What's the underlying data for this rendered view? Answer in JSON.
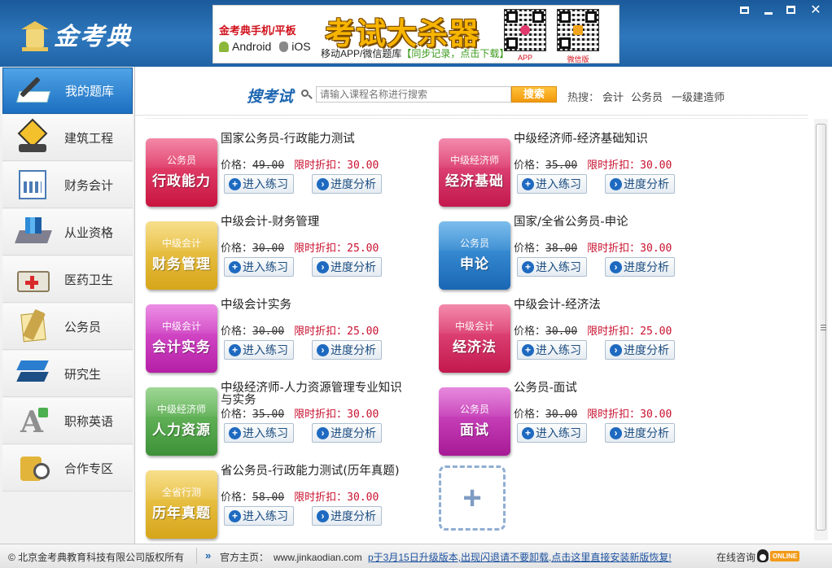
{
  "app": {
    "logo_text": "金考典",
    "window_controls": [
      "tile",
      "minimize",
      "maximize",
      "close"
    ]
  },
  "banner": {
    "line1": "金考典手机/平板",
    "os_android": "Android",
    "os_ios": "iOS",
    "headline": "考试大杀器",
    "sub_prefix": "移动APP/微信题库",
    "sub_highlight": "【同步记录，点击下载】",
    "qr1_caption": "APP",
    "qr2_caption": "微信版"
  },
  "sidebar": {
    "items": [
      {
        "label": "我的题库",
        "icon": "book-pen-icon",
        "active": true
      },
      {
        "label": "建筑工程",
        "icon": "construction-sign-icon",
        "active": false
      },
      {
        "label": "财务会计",
        "icon": "finance-chart-icon",
        "active": false
      },
      {
        "label": "从业资格",
        "icon": "bar-chart-icon",
        "active": false
      },
      {
        "label": "医药卫生",
        "icon": "medical-kit-icon",
        "active": false
      },
      {
        "label": "公务员",
        "icon": "civil-servant-icon",
        "active": false
      },
      {
        "label": "研究生",
        "icon": "layers-icon",
        "active": false
      },
      {
        "label": "职称英语",
        "icon": "letter-a-icon",
        "active": false
      },
      {
        "label": "合作专区",
        "icon": "cooperation-icon",
        "active": false
      }
    ]
  },
  "search": {
    "title": "搜考试",
    "placeholder": "请输入课程名称进行搜索",
    "button": "搜索",
    "hot_label": "热搜：",
    "hot_tags": [
      "会计",
      "公务员",
      "一级建造师"
    ]
  },
  "labels": {
    "price": "价格：",
    "discount": "限时折扣：",
    "practice": "进入练习",
    "analyze": "进度分析"
  },
  "courses": [
    {
      "name": "国家公务员-行政能力测试",
      "tile_small": "公务员",
      "tile_big": "行政能力",
      "color": "#d91a4d",
      "price": "49.00",
      "discount": "30.00"
    },
    {
      "name": "中级经济师-经济基础知识",
      "tile_small": "中级经济师",
      "tile_big": "经济基础",
      "color": "#d4184f",
      "price": "35.00",
      "discount": "30.00"
    },
    {
      "name": "中级会计-财务管理",
      "tile_small": "中级会计",
      "tile_big": "财务管理",
      "color": "#e0b32a",
      "price": "30.00",
      "discount": "25.00"
    },
    {
      "name": "国家/全省公务员-申论",
      "tile_small": "公务员",
      "tile_big": "申论",
      "color": "#2176c8",
      "price": "38.00",
      "discount": "30.00"
    },
    {
      "name": "中级会计实务",
      "tile_small": "中级会计",
      "tile_big": "会计实务",
      "color": "#c934bb",
      "price": "30.00",
      "discount": "25.00"
    },
    {
      "name": "中级会计-经济法",
      "tile_small": "中级会计",
      "tile_big": "经济法",
      "color": "#d0205a",
      "price": "30.00",
      "discount": "25.00"
    },
    {
      "name": "中级经济师-人力资源管理专业知识与实务",
      "tile_small": "中级经济师",
      "tile_big": "人力资源",
      "color": "#52a547",
      "price": "35.00",
      "discount": "30.00"
    },
    {
      "name": "公务员-面试",
      "tile_small": "公务员",
      "tile_big": "面试",
      "color": "#b827a6",
      "price": "30.00",
      "discount": "30.00"
    },
    {
      "name": "省公务员-行政能力测试(历年真题)",
      "tile_small": "全省行测",
      "tile_big": "历年真题",
      "color": "#e0b32a",
      "price": "58.00",
      "discount": "30.00"
    }
  ],
  "add_tile": "+",
  "statusbar": {
    "copyright": "© 北京金考典教育科技有限公司版权所有",
    "home_label": "官方主页：",
    "home_url": "www.jinkaodian.com",
    "notice": "p于3月15日升级版本,出现闪退请不要卸载,点击这里直接安装新版恢复!",
    "online_label": "在线咨询",
    "online_badge": "ONLINE"
  }
}
